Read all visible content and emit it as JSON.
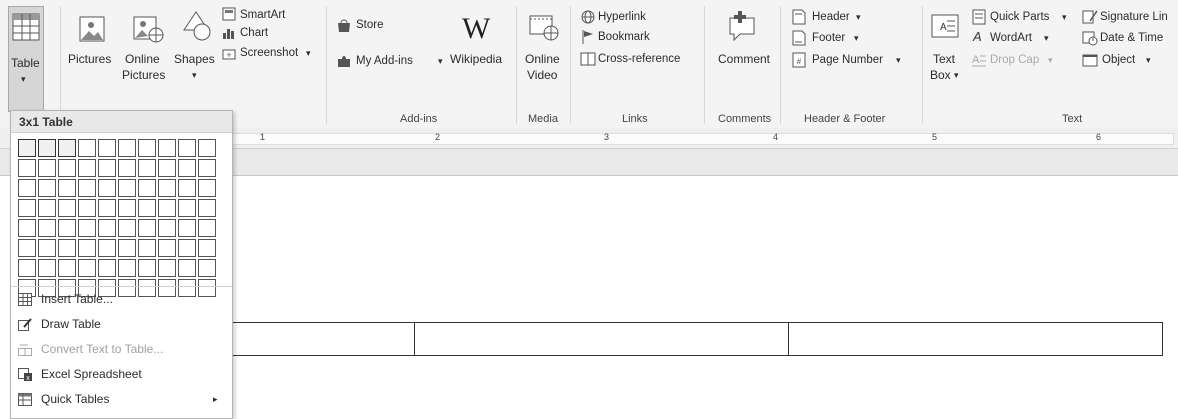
{
  "ribbon": {
    "tables": {
      "label_1": "Table",
      "arrow": "▾"
    },
    "illustrations": {
      "pictures": "Pictures",
      "online_pictures_1": "Online",
      "online_pictures_2": "Pictures",
      "shapes": "Shapes",
      "smartart": "SmartArt",
      "chart": "Chart",
      "screenshot": "Screenshot",
      "dropdown_arrow": "▾"
    },
    "addins": {
      "store": "Store",
      "wikipedia": "Wikipedia",
      "wikipedia_logo": "W",
      "my_addins": "My Add-ins",
      "group_label": "Add-ins"
    },
    "media": {
      "online_video_1": "Online",
      "online_video_2": "Video",
      "group_label": "Media"
    },
    "links": {
      "hyperlink": "Hyperlink",
      "bookmark": "Bookmark",
      "cross_reference": "Cross-reference",
      "group_label": "Links"
    },
    "comments": {
      "comment": "Comment",
      "group_label": "Comments"
    },
    "header_footer": {
      "header": "Header",
      "footer": "Footer",
      "page_number": "Page Number",
      "group_label": "Header & Footer"
    },
    "text": {
      "text_box_1": "Text",
      "text_box_2": "Box",
      "quick_parts": "Quick Parts",
      "wordart": "WordArt",
      "drop_cap": "Drop Cap",
      "signature_line": "Signature Lin",
      "date_time": "Date & Time",
      "object": "Object",
      "group_label": "Text"
    }
  },
  "ruler": {
    "numbers": [
      "1",
      "2",
      "3",
      "4",
      "5",
      "6"
    ]
  },
  "table_dropdown": {
    "title": "3x1 Table",
    "grid_cols": 10,
    "grid_rows": 8,
    "selected_cols": 3,
    "selected_rows": 1,
    "items": [
      {
        "label": "Insert Table...",
        "disabled": false,
        "submenu": false
      },
      {
        "label": "Draw Table",
        "disabled": false,
        "submenu": false
      },
      {
        "label": "Convert Text to Table...",
        "disabled": true,
        "submenu": false
      },
      {
        "label": "Excel Spreadsheet",
        "disabled": false,
        "submenu": false
      },
      {
        "label": "Quick Tables",
        "disabled": false,
        "submenu": true
      }
    ],
    "submenu_arrow": "▸"
  }
}
